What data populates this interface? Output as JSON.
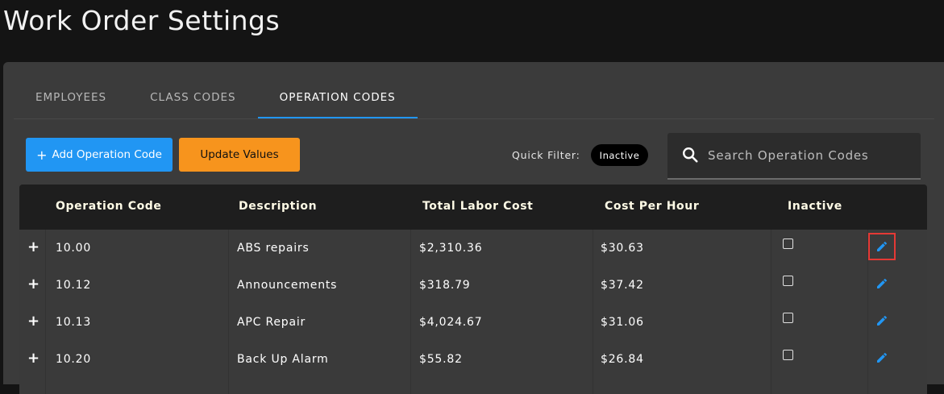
{
  "page": {
    "title": "Work Order Settings"
  },
  "tabs": [
    {
      "label": "EMPLOYEES"
    },
    {
      "label": "CLASS CODES"
    },
    {
      "label": "OPERATION CODES"
    }
  ],
  "toolbar": {
    "add_label": "Add Operation Code",
    "add_icon": "+",
    "update_label": "Update Values",
    "quick_filter_label": "Quick Filter:",
    "quick_filter_chip": "Inactive"
  },
  "search": {
    "placeholder": "Search Operation Codes",
    "value": ""
  },
  "table": {
    "columns": [
      "Operation Code",
      "Description",
      "Total Labor Cost",
      "Cost Per Hour",
      "Inactive"
    ],
    "rows": [
      {
        "expand": "+",
        "code": "10.00",
        "description": "ABS repairs",
        "total_labor_cost": "$2,310.36",
        "cost_per_hour": "$30.63",
        "inactive": false
      },
      {
        "expand": "+",
        "code": "10.12",
        "description": "Announcements",
        "total_labor_cost": "$318.79",
        "cost_per_hour": "$37.42",
        "inactive": false
      },
      {
        "expand": "+",
        "code": "10.13",
        "description": "APC Repair",
        "total_labor_cost": "$4,024.67",
        "cost_per_hour": "$31.06",
        "inactive": false
      },
      {
        "expand": "+",
        "code": "10.20",
        "description": "Back Up Alarm",
        "total_labor_cost": "$55.82",
        "cost_per_hour": "$26.84",
        "inactive": false
      }
    ]
  },
  "colors": {
    "accent": "#2196f3",
    "warning": "#f7941d",
    "highlight": "#e53935",
    "background": "#141414",
    "panel": "#3b3b3b"
  },
  "icons": {
    "search": "search-icon",
    "edit": "pencil-icon",
    "expand": "plus-icon"
  }
}
